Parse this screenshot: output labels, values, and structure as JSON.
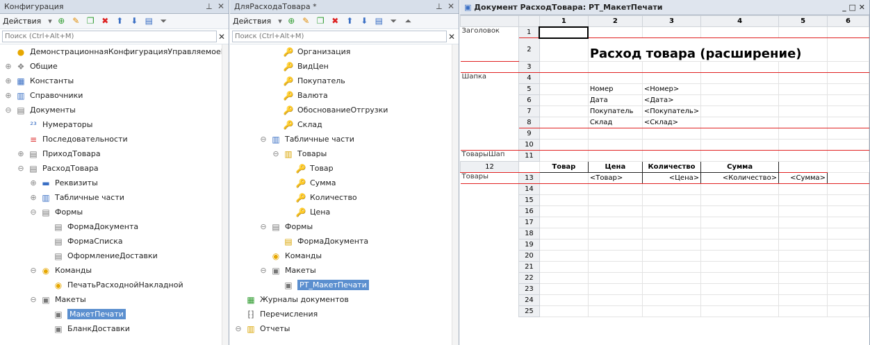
{
  "left_panel": {
    "title": "Конфигурация",
    "actions": "Действия",
    "search_placeholder": "Поиск (Ctrl+Alt+M)",
    "items": [
      {
        "label": "ДемонстрационнаяКонфигурацияУправляемоеП",
        "level": 0,
        "exp": "",
        "icon": "config-icon",
        "glyph": "●",
        "color": "#e6a700"
      },
      {
        "label": "Общие",
        "level": 0,
        "exp": "⊕",
        "icon": "common-icon",
        "glyph": "❖",
        "color": "#888"
      },
      {
        "label": "Константы",
        "level": 0,
        "exp": "⊕",
        "icon": "constants-icon",
        "glyph": "▦",
        "color": "#3a6fc4"
      },
      {
        "label": "Справочники",
        "level": 0,
        "exp": "⊕",
        "icon": "catalogs-icon",
        "glyph": "▥",
        "color": "#3a6fc4"
      },
      {
        "label": "Документы",
        "level": 0,
        "exp": "⊖",
        "icon": "documents-icon",
        "glyph": "▤",
        "color": "#777"
      },
      {
        "label": "Нумераторы",
        "level": 1,
        "exp": "",
        "icon": "numerators-icon",
        "glyph": "²³",
        "color": "#3a6fc4"
      },
      {
        "label": "Последовательности",
        "level": 1,
        "exp": "",
        "icon": "sequences-icon",
        "glyph": "≡",
        "color": "#d33"
      },
      {
        "label": "ПриходТовара",
        "level": 1,
        "exp": "⊕",
        "icon": "document-icon",
        "glyph": "▤",
        "color": "#777"
      },
      {
        "label": "РасходТовара",
        "level": 1,
        "exp": "⊖",
        "icon": "document-icon",
        "glyph": "▤",
        "color": "#777"
      },
      {
        "label": "Реквизиты",
        "level": 2,
        "exp": "⊕",
        "icon": "attributes-icon",
        "glyph": "▬",
        "color": "#3a6fc4"
      },
      {
        "label": "Табличные части",
        "level": 2,
        "exp": "⊕",
        "icon": "tabular-icon",
        "glyph": "▥",
        "color": "#3a6fc4"
      },
      {
        "label": "Формы",
        "level": 2,
        "exp": "⊖",
        "icon": "forms-icon",
        "glyph": "▤",
        "color": "#777"
      },
      {
        "label": "ФормаДокумента",
        "level": 3,
        "exp": "",
        "icon": "form-icon",
        "glyph": "▤",
        "color": "#777"
      },
      {
        "label": "ФормаСписка",
        "level": 3,
        "exp": "",
        "icon": "form-icon",
        "glyph": "▤",
        "color": "#777"
      },
      {
        "label": "ОформлениеДоставки",
        "level": 3,
        "exp": "",
        "icon": "form-icon",
        "glyph": "▤",
        "color": "#777"
      },
      {
        "label": "Команды",
        "level": 2,
        "exp": "⊖",
        "icon": "commands-icon",
        "glyph": "◉",
        "color": "#e6a700"
      },
      {
        "label": "ПечатьРасходнойНакладной",
        "level": 3,
        "exp": "",
        "icon": "command-icon",
        "glyph": "◉",
        "color": "#e6a700"
      },
      {
        "label": "Макеты",
        "level": 2,
        "exp": "⊖",
        "icon": "templates-icon",
        "glyph": "▣",
        "color": "#777"
      },
      {
        "label": "МакетПечати",
        "level": 3,
        "exp": "",
        "icon": "template-icon",
        "glyph": "▣",
        "color": "#777",
        "selected": true
      },
      {
        "label": "БланкДоставки",
        "level": 3,
        "exp": "",
        "icon": "template-icon",
        "glyph": "▣",
        "color": "#777"
      }
    ]
  },
  "mid_panel": {
    "title": "ДляРасходаТовара *",
    "actions": "Действия",
    "search_placeholder": "Поиск (Ctrl+Alt+M)",
    "items": [
      {
        "label": "Организация",
        "level": 3,
        "exp": "",
        "icon": "attribute-icon",
        "glyph": "🔑",
        "color": "#d9a400"
      },
      {
        "label": "ВидЦен",
        "level": 3,
        "exp": "",
        "icon": "attribute-icon",
        "glyph": "🔑",
        "color": "#d9a400"
      },
      {
        "label": "Покупатель",
        "level": 3,
        "exp": "",
        "icon": "attribute-icon",
        "glyph": "🔑",
        "color": "#d9a400"
      },
      {
        "label": "Валюта",
        "level": 3,
        "exp": "",
        "icon": "attribute-icon",
        "glyph": "🔑",
        "color": "#d9a400"
      },
      {
        "label": "ОбоснованиеОтгрузки",
        "level": 3,
        "exp": "",
        "icon": "attribute-icon",
        "glyph": "🔑",
        "color": "#d9a400"
      },
      {
        "label": "Склад",
        "level": 3,
        "exp": "",
        "icon": "attribute-icon",
        "glyph": "🔑",
        "color": "#d9a400"
      },
      {
        "label": "Табличные части",
        "level": 2,
        "exp": "⊖",
        "icon": "tabular-icon",
        "glyph": "▥",
        "color": "#3a6fc4"
      },
      {
        "label": "Товары",
        "level": 3,
        "exp": "⊖",
        "icon": "tabular-icon",
        "glyph": "▥",
        "color": "#d9a400"
      },
      {
        "label": "Товар",
        "level": 4,
        "exp": "",
        "icon": "attribute-icon",
        "glyph": "🔑",
        "color": "#d9a400"
      },
      {
        "label": "Сумма",
        "level": 4,
        "exp": "",
        "icon": "attribute-icon",
        "glyph": "🔑",
        "color": "#d9a400"
      },
      {
        "label": "Количество",
        "level": 4,
        "exp": "",
        "icon": "attribute-icon",
        "glyph": "🔑",
        "color": "#d9a400"
      },
      {
        "label": "Цена",
        "level": 4,
        "exp": "",
        "icon": "attribute-icon",
        "glyph": "🔑",
        "color": "#d9a400"
      },
      {
        "label": "Формы",
        "level": 2,
        "exp": "⊖",
        "icon": "forms-icon",
        "glyph": "▤",
        "color": "#777"
      },
      {
        "label": "ФормаДокумента",
        "level": 3,
        "exp": "",
        "icon": "form-icon",
        "glyph": "▤",
        "color": "#d9a400"
      },
      {
        "label": "Команды",
        "level": 2,
        "exp": "",
        "icon": "commands-icon",
        "glyph": "◉",
        "color": "#e6a700"
      },
      {
        "label": "Макеты",
        "level": 2,
        "exp": "⊖",
        "icon": "templates-icon",
        "glyph": "▣",
        "color": "#777"
      },
      {
        "label": "РТ_МакетПечати",
        "level": 3,
        "exp": "",
        "icon": "template-icon",
        "glyph": "▣",
        "color": "#777",
        "selected": true
      },
      {
        "label": "Журналы документов",
        "level": 0,
        "exp": "",
        "icon": "journals-icon",
        "glyph": "▦",
        "color": "#2e9b2e"
      },
      {
        "label": "Перечисления",
        "level": 0,
        "exp": "",
        "icon": "enums-icon",
        "glyph": "⁅⁆",
        "color": "#666"
      },
      {
        "label": "Отчеты",
        "level": 0,
        "exp": "⊖",
        "icon": "reports-icon",
        "glyph": "▥",
        "color": "#d9a400"
      }
    ]
  },
  "doc": {
    "title": "Документ РасходТовара: РТ_МакетПечати",
    "col_headers": [
      "1",
      "2",
      "3",
      "4",
      "5",
      "6"
    ],
    "row_numbers": [
      "1",
      "2",
      "3",
      "4",
      "5",
      "6",
      "7",
      "8",
      "9",
      "10",
      "11",
      "12",
      "13",
      "14",
      "15",
      "16",
      "17",
      "18",
      "19",
      "20",
      "21",
      "22",
      "23",
      "24",
      "25"
    ],
    "sections": {
      "header": "Заголовок",
      "cap": "Шапка",
      "goods_cap": "ТоварыШап",
      "goods": "Товары"
    },
    "heading": "Расход товара (расширение)",
    "fields": [
      [
        "Номер",
        "<Номер>"
      ],
      [
        "Дата",
        "<Дата>"
      ],
      [
        "Покупатель",
        "<Покупатель>"
      ],
      [
        "Склад",
        "<Склад>"
      ]
    ],
    "table_headers": [
      "Товар",
      "Цена",
      "Количество",
      "Сумма"
    ],
    "table_row": [
      "<Товар>",
      "<Цена>",
      "<Количество>",
      "<Сумма>"
    ]
  }
}
